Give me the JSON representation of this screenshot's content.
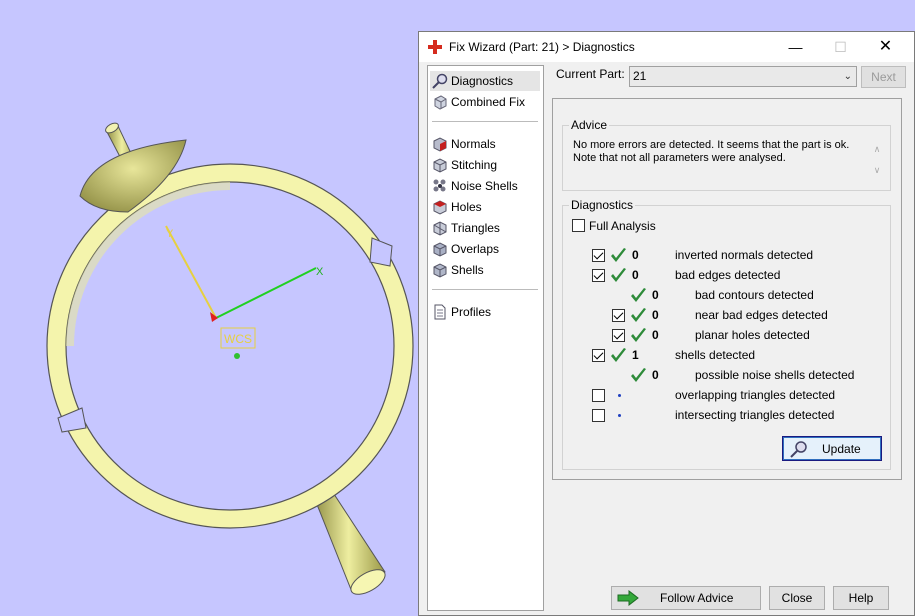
{
  "viewport": {
    "background_color": "#c6c6ff",
    "axis_y_label": "Y",
    "axis_x_label": "X",
    "wcs_label": "WCS"
  },
  "dialog": {
    "title": "Fix Wizard (Part: 21) > Diagnostics",
    "title_icon": "red-cross-icon",
    "controls": {
      "minimize": "—",
      "maximize": "☐",
      "close": "✕"
    },
    "nav": {
      "group1": [
        {
          "label": "Diagnostics",
          "icon": "magnifier-icon",
          "selected": true
        },
        {
          "label": "Combined Fix",
          "icon": "cube-icon"
        }
      ],
      "group2": [
        {
          "label": "Normals",
          "icon": "normals-cube-icon"
        },
        {
          "label": "Stitching",
          "icon": "stitching-cube-icon"
        },
        {
          "label": "Noise Shells",
          "icon": "noise-shells-icon"
        },
        {
          "label": "Holes",
          "icon": "holes-cube-icon"
        },
        {
          "label": "Triangles",
          "icon": "triangles-cube-icon"
        },
        {
          "label": "Overlaps",
          "icon": "overlaps-cube-icon"
        },
        {
          "label": "Shells",
          "icon": "shells-cube-icon"
        }
      ],
      "group3": [
        {
          "label": "Profiles",
          "icon": "document-icon"
        }
      ]
    },
    "current_part": {
      "label": "Current Part:",
      "value": "21"
    },
    "next_label": "Next",
    "advice": {
      "title": "Advice",
      "line1": "No more errors are detected. It seems that the part is ok.",
      "line2": "Note that not all parameters were analysed."
    },
    "diagnostics": {
      "title": "Diagnostics",
      "full_analysis_label": "Full Analysis",
      "full_analysis_checked": false,
      "rows": [
        {
          "label": "inverted normals detected",
          "count": "0",
          "checkbox": true,
          "checked": true,
          "status": "ok",
          "indent": 0
        },
        {
          "label": "bad edges detected",
          "count": "0",
          "checkbox": true,
          "checked": true,
          "status": "ok",
          "indent": 0
        },
        {
          "label": "bad contours detected",
          "count": "0",
          "checkbox": false,
          "checked": false,
          "status": "ok",
          "indent": 1
        },
        {
          "label": "near bad edges detected",
          "count": "0",
          "checkbox": true,
          "checked": true,
          "status": "ok",
          "indent": 1
        },
        {
          "label": "planar holes detected",
          "count": "0",
          "checkbox": true,
          "checked": true,
          "status": "ok",
          "indent": 1
        },
        {
          "label": "shells detected",
          "count": "1",
          "checkbox": true,
          "checked": true,
          "status": "ok",
          "indent": 0
        },
        {
          "label": "possible noise shells detected",
          "count": "0",
          "checkbox": false,
          "checked": false,
          "status": "ok",
          "indent": 1
        },
        {
          "label": "overlapping triangles detected",
          "count": "",
          "checkbox": true,
          "checked": false,
          "status": "dot",
          "indent": 0
        },
        {
          "label": "intersecting triangles detected",
          "count": "",
          "checkbox": true,
          "checked": false,
          "status": "dot",
          "indent": 0
        }
      ]
    },
    "update_label": "Update",
    "follow_advice_label": "Follow Advice",
    "close_label": "Close",
    "help_label": "Help",
    "colors": {
      "check_green": "#2e8b3a",
      "accent_blue": "#2f6fbf",
      "title_red": "#d52b1e",
      "arrow_green": "#34a83a"
    }
  }
}
